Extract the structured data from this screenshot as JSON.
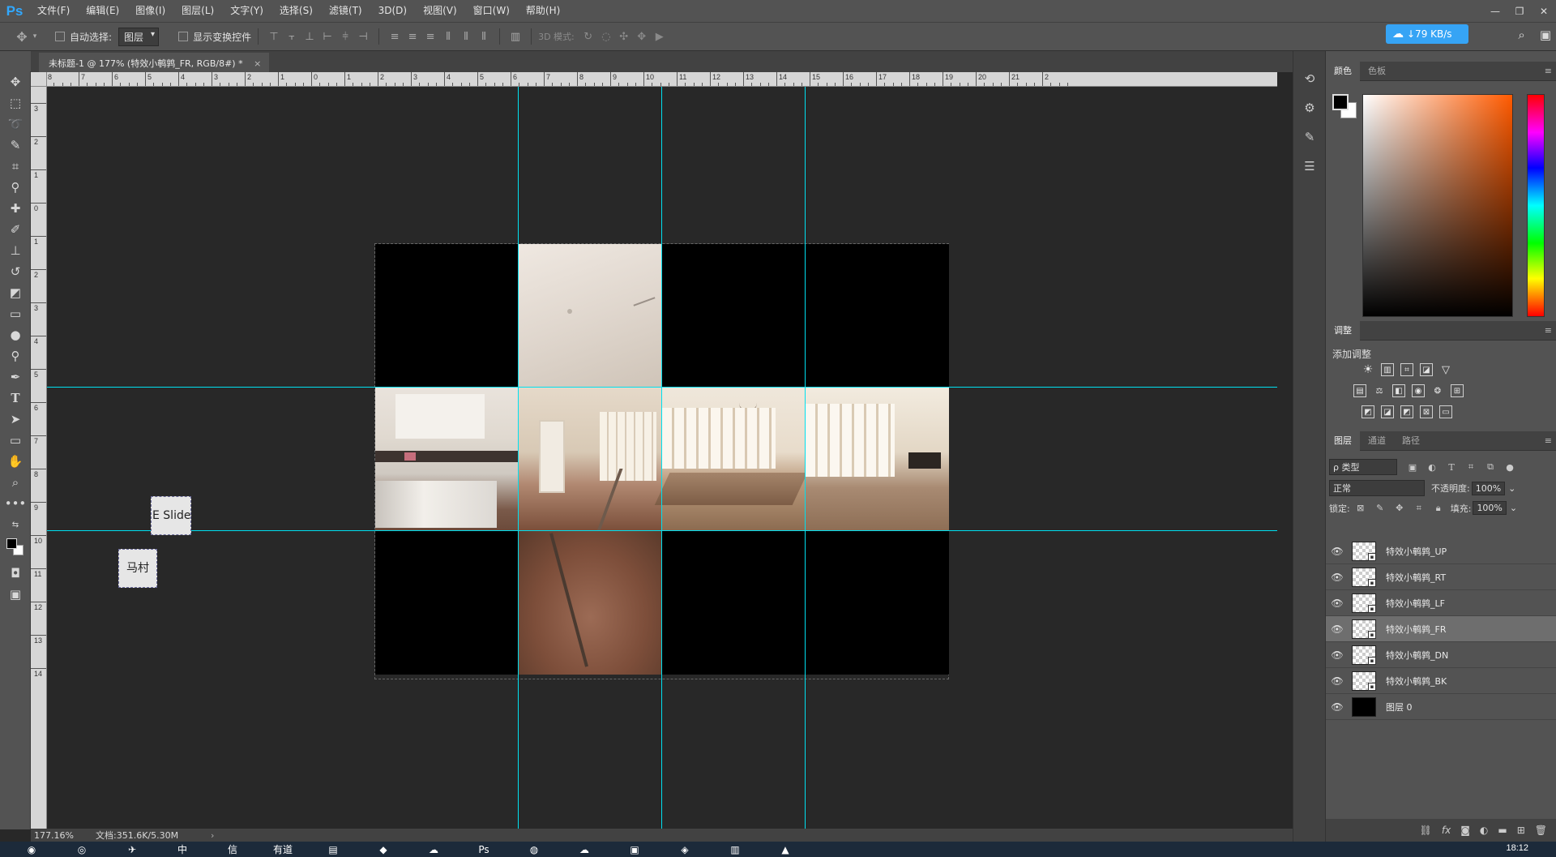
{
  "app": {
    "logo": "Ps"
  },
  "menu": [
    "文件(F)",
    "编辑(E)",
    "图像(I)",
    "图层(L)",
    "文字(Y)",
    "选择(S)",
    "滤镜(T)",
    "3D(D)",
    "视图(V)",
    "窗口(W)",
    "帮助(H)"
  ],
  "window_controls": {
    "minimize": "—",
    "restore": "❐",
    "close": "✕"
  },
  "options": {
    "auto_select_label": "自动选择:",
    "auto_select_value": "图层",
    "show_transform_label": "显示变换控件",
    "mode_3d_label": "3D 模式:"
  },
  "speed": {
    "value": "↓79 KB/s"
  },
  "document": {
    "tab_title": "未标题-1 @ 177% (特效小鹌鹑_FR, RGB/8#) *",
    "close": "×"
  },
  "ruler": {
    "top_labels": [
      "8",
      "7",
      "6",
      "5",
      "4",
      "3",
      "2",
      "1",
      "0",
      "1",
      "2",
      "3",
      "4",
      "5",
      "6",
      "7",
      "8",
      "9",
      "10",
      "11",
      "12",
      "13",
      "14",
      "15",
      "16",
      "17",
      "18",
      "19",
      "20",
      "21",
      "2"
    ],
    "left_labels": [
      "3",
      "2",
      "1",
      "0",
      "1",
      "2",
      "3",
      "4",
      "5",
      "6",
      "7",
      "8",
      "9",
      "10",
      "11",
      "12",
      "13",
      "14"
    ]
  },
  "canvas": {
    "float_texts": [
      "E Slide",
      "马村"
    ]
  },
  "status": {
    "zoom": "177.16%",
    "doc": "文档:351.6K/5.30M",
    "arrow": "›"
  },
  "panels": {
    "color_tabs": [
      "颜色",
      "色板"
    ],
    "adjust_tab": "调整",
    "adjust_label": "添加调整",
    "layer_tabs": [
      "图层",
      "通道",
      "路径"
    ],
    "filter_type": "ρ 类型",
    "blend_mode": "正常",
    "opacity_label": "不透明度:",
    "opacity_value": "100%",
    "lock_label": "锁定:",
    "fill_label": "填充:",
    "fill_value": "100%",
    "menu_icon": "≡"
  },
  "layers": [
    {
      "name": "特效小鹌鹑_UP",
      "selected": false,
      "type": "smart"
    },
    {
      "name": "特效小鹌鹑_RT",
      "selected": false,
      "type": "smart"
    },
    {
      "name": "特效小鹌鹑_LF",
      "selected": false,
      "type": "smart"
    },
    {
      "name": "特效小鹌鹑_FR",
      "selected": true,
      "type": "smart"
    },
    {
      "name": "特效小鹌鹑_DN",
      "selected": false,
      "type": "smart"
    },
    {
      "name": "特效小鹌鹑_BK",
      "selected": false,
      "type": "smart"
    },
    {
      "name": "图层 0",
      "selected": false,
      "type": "fill"
    }
  ],
  "taskbar": {
    "apps": [
      "◉",
      "◎",
      "✈",
      "中",
      "信",
      "有道",
      "▤",
      "◆",
      "☁",
      "Ps",
      "◍",
      "☁",
      "▣",
      "◈",
      "▥",
      "▲"
    ],
    "clock": "18:12"
  },
  "colors": {
    "guide": "#00e0f0",
    "accent": "#36a4f5",
    "chrome": "#535353",
    "canvas": "#282828"
  }
}
